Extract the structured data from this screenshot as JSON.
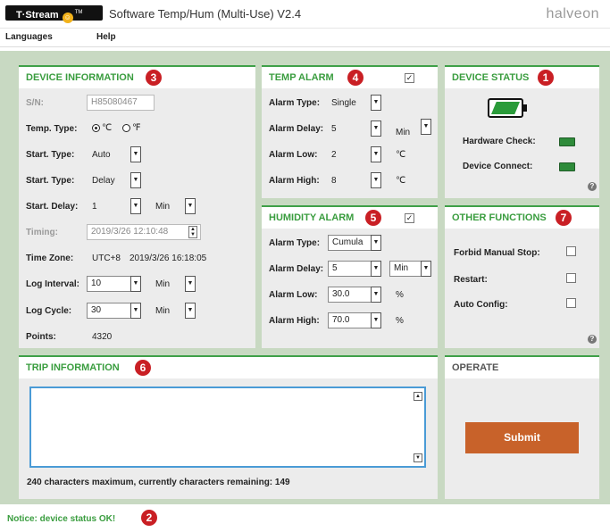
{
  "titlebar": {
    "brand": "T·Stream",
    "brand_mark": "TM",
    "app_title": "Software Temp/Hum (Multi-Use) V2.4",
    "logo": "halveon"
  },
  "menu": {
    "languages": "Languages",
    "help": "Help"
  },
  "device_info": {
    "title": "DEVICE INFORMATION",
    "badge": "3",
    "sn_label": "S/N:",
    "sn_value": "H85080467",
    "temp_type_label": "Temp. Type:",
    "temp_c": "℃",
    "temp_f": "℉",
    "start_type_label": "Start. Type:",
    "start_type_value": "Auto",
    "start_type2_label": "Start. Type:",
    "start_type2_value": "Delay",
    "start_delay_label": "Start. Delay:",
    "start_delay_value": "1",
    "start_delay_unit": "Min",
    "timing_label": "Timing:",
    "timing_value": "2019/3/26  12:10:48",
    "timezone_label": "Time Zone:",
    "timezone_value": "UTC+8",
    "timezone_time": "2019/3/26  16:18:05",
    "log_interval_label": "Log Interval:",
    "log_interval_value": "10",
    "log_interval_unit": "Min",
    "log_cycle_label": "Log Cycle:",
    "log_cycle_value": "30",
    "log_cycle_unit": "Min",
    "points_label": "Points:",
    "points_value": "4320"
  },
  "temp_alarm": {
    "title": "TEMP ALARM",
    "badge": "4",
    "checked": "✓",
    "type_label": "Alarm Type:",
    "type_value": "Single",
    "delay_label": "Alarm Delay:",
    "delay_value": "5",
    "delay_unit": "Min",
    "low_label": "Alarm Low:",
    "low_value": "2",
    "low_unit": "℃",
    "high_label": "Alarm High:",
    "high_value": "8",
    "high_unit": "℃"
  },
  "humidity_alarm": {
    "title": "HUMIDITY ALARM",
    "badge": "5",
    "checked": "✓",
    "type_label": "Alarm Type:",
    "type_value": "Cumula",
    "delay_label": "Alarm Delay:",
    "delay_value": "5",
    "delay_unit": "Min",
    "low_label": "Alarm Low:",
    "low_value": "30.0",
    "low_unit": "%",
    "high_label": "Alarm High:",
    "high_value": "70.0",
    "high_unit": "%"
  },
  "device_status": {
    "title": "DEVICE STATUS",
    "badge": "1",
    "hardware_label": "Hardware Check:",
    "connect_label": "Device Connect:",
    "led_color": "#2e8b3a"
  },
  "other_functions": {
    "title": "OTHER FUNCTIONS",
    "badge": "7",
    "forbid_label": "Forbid Manual Stop:",
    "restart_label": "Restart:",
    "autoconfig_label": "Auto Config:"
  },
  "trip_info": {
    "title": "TRIP INFORMATION",
    "badge": "6",
    "remaining": "240 characters maximum, currently characters remaining: 149"
  },
  "operate": {
    "title": "OPERATE",
    "submit": "Submit"
  },
  "notice": {
    "text": "Notice: device status OK!",
    "badge": "2"
  },
  "colors": {
    "accent": "#3a9d3f",
    "badge": "#c91f24",
    "submit": "#c8622a",
    "frame": "#c8d9c2"
  }
}
